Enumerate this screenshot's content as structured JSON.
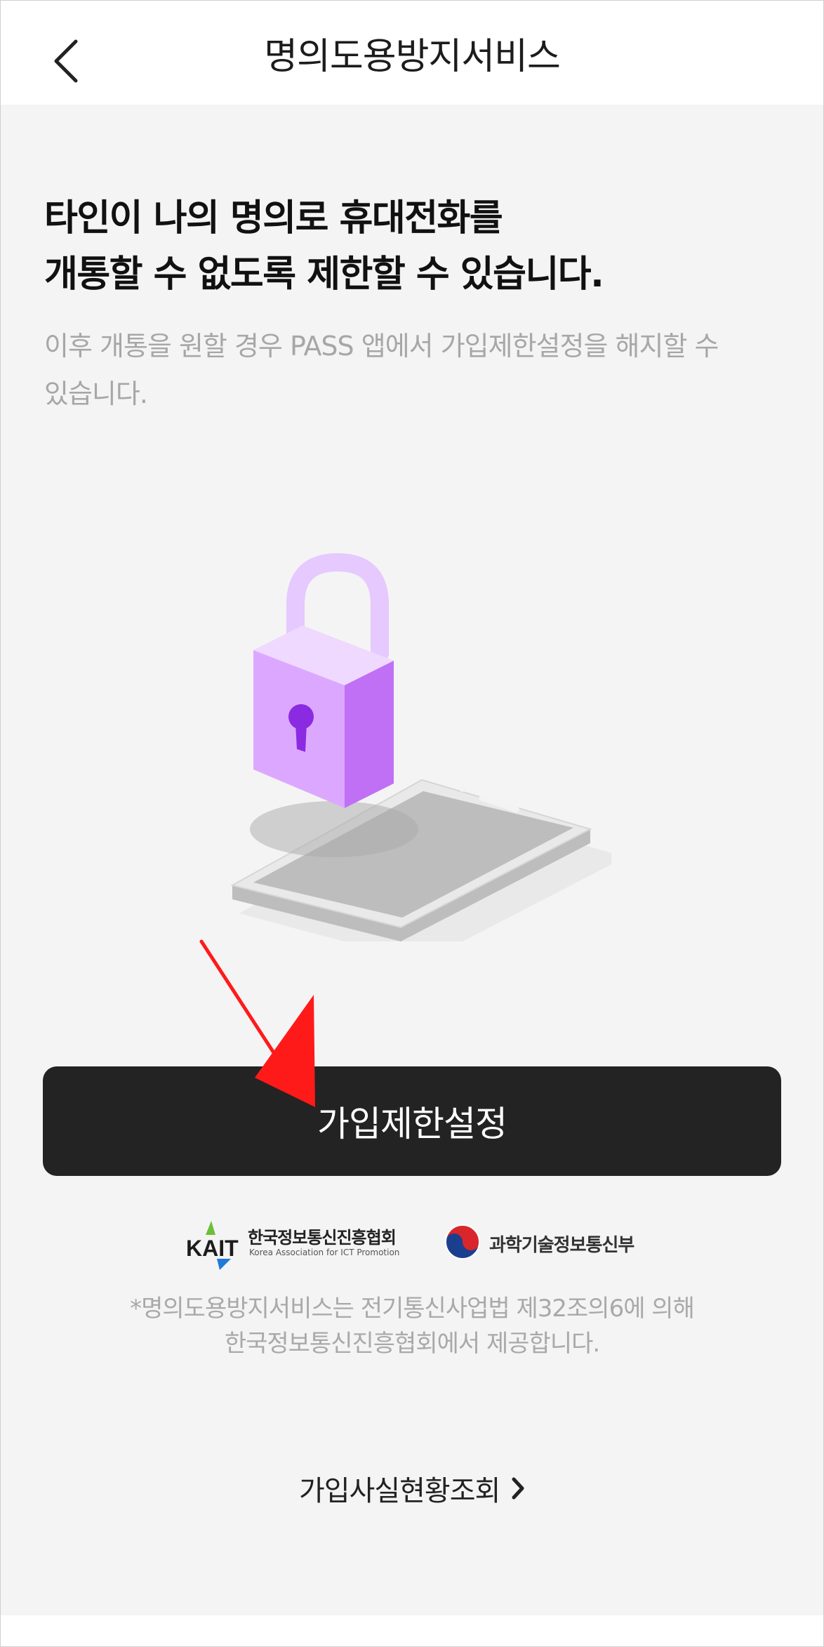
{
  "header": {
    "title": "명의도용방지서비스",
    "back_icon": "chevron-left-icon"
  },
  "main": {
    "headline_line1": "타인이 나의 명의로 휴대전화를",
    "headline_line2": "개통할 수 없도록 제한할 수 있습니다.",
    "subtext_line1": "이후 개통을 원할 경우 PASS 앱에서 가입제한설정을 해지할 수",
    "subtext_line2": "있습니다.",
    "illustration_icon": "padlock-phone-illustration"
  },
  "primary_button": {
    "label": "가입제한설정"
  },
  "logos": {
    "kait_mark": "KAIT",
    "kait_name": "한국정보통신진흥협회",
    "kait_english": "Korea Association for ICT Promotion",
    "msit_name": "과학기술정보통신부"
  },
  "notice": {
    "line1": "*명의도용방지서비스는 전기통신사업법 제32조의6에 의해",
    "line2": "한국정보통신진흥협회에서 제공합니다."
  },
  "bottom_link": {
    "label": "가입사실현황조회",
    "icon": "chevron-right-icon"
  },
  "colors": {
    "background": "#f4f4f4",
    "header": "#ffffff",
    "button": "#232323",
    "lock": "#c77dff",
    "arrow": "#ff1a1a"
  }
}
